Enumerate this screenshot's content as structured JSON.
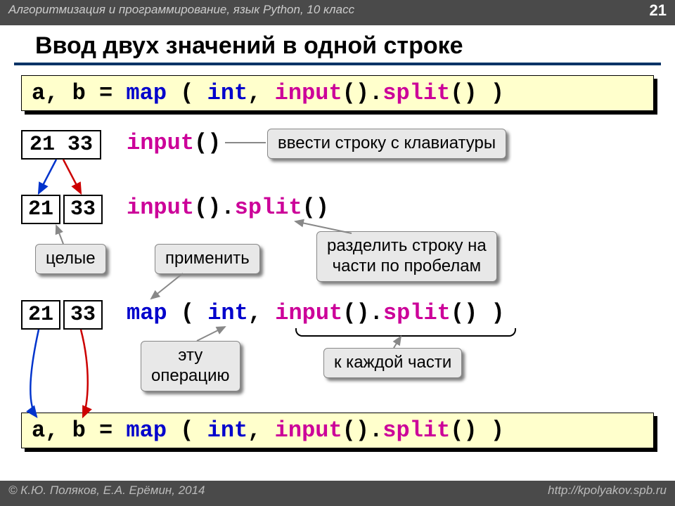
{
  "header": {
    "course": "Алгоритмизация и программирование, язык Python, 10 класс",
    "page": "21"
  },
  "title": "Ввод двух значений в одной строке",
  "codebar1": {
    "ab": "a, b = ",
    "map": "map",
    "lp": " ( ",
    "int": "int",
    "comma": ", ",
    "inp": "input",
    "paren": "().",
    "split": "split",
    "end": "() )"
  },
  "row1": {
    "box": "21 33",
    "code_inp": "input",
    "code_par": "()",
    "callout": "ввести строку с клавиатуры"
  },
  "row2": {
    "box_a": "21",
    "box_b": "33",
    "code_inp": "input",
    "code_mid": "().",
    "code_split": "split",
    "code_end": "()",
    "callout": "разделить строку на\nчасти по пробелам"
  },
  "labels": {
    "whole": "целые",
    "apply": "применить",
    "thisop": "эту\nоперацию",
    "each": "к каждой части"
  },
  "row3": {
    "box_a": "21",
    "box_b": "33",
    "map": "map",
    "lp": " ( ",
    "int": "int",
    "comma": ", ",
    "inp": "input",
    "paren": "().",
    "split": "split",
    "end": "() )"
  },
  "footer": {
    "copy": "© К.Ю. Поляков, Е.А. Ерёмин, 2014",
    "site": "http://kpolyakov.spb.ru"
  }
}
